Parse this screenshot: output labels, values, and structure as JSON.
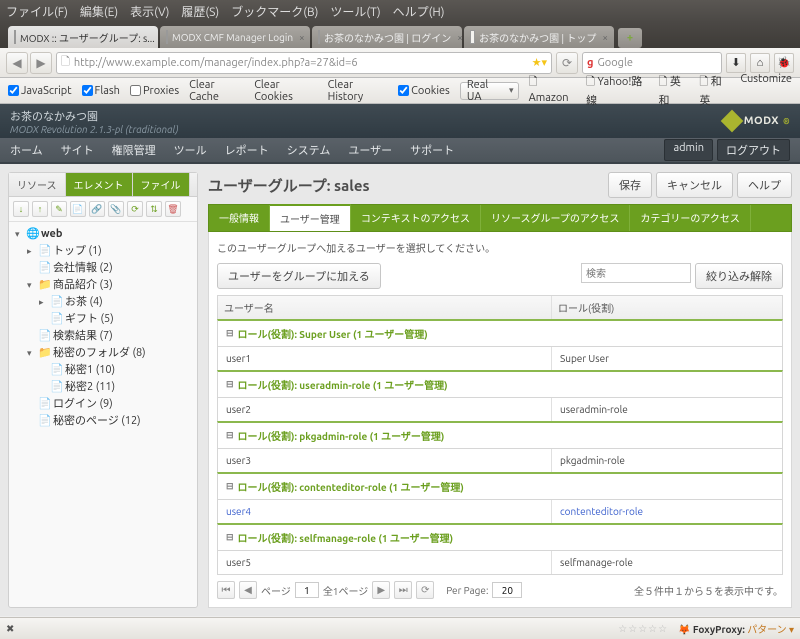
{
  "os_menu": [
    "ファイル(F)",
    "編集(E)",
    "表示(V)",
    "履歴(S)",
    "ブックマーク(B)",
    "ツール(T)",
    "ヘルプ(H)"
  ],
  "browser_tabs": [
    {
      "label": "MODX :: ユーザーグループ: s...",
      "active": true
    },
    {
      "label": "MODX CMF Manager Login",
      "active": false
    },
    {
      "label": "お茶のなかみつ園 | ログイン",
      "active": false
    },
    {
      "label": "お茶のなかみつ園 | トップ",
      "active": false
    }
  ],
  "url": "http://www.example.com/manager/index.php?a=27&id=6",
  "search_placeholder": "Google",
  "toolbar": {
    "javascript": "JavaScript",
    "flash": "Flash",
    "proxies": "Proxies",
    "clear_cache": "Clear Cache",
    "clear_cookies": "Clear Cookies",
    "clear_history": "Clear History",
    "cookies": "Cookies",
    "real_ua": "Real UA",
    "amazon": "Amazon",
    "yahoo": "Yahoo!路線",
    "eiwa": "英和",
    "waei": "和英",
    "customize": "Customize"
  },
  "modx": {
    "site_title": "お茶のなかみつ園",
    "version": "MODX Revolution 2.1.3-pl (traditional)",
    "logo": "MODX",
    "nav": [
      "ホーム",
      "サイト",
      "権限管理",
      "ツール",
      "レポート",
      "システム",
      "ユーザー",
      "サポート"
    ],
    "user": "admin",
    "logout": "ログアウト"
  },
  "left_tabs": [
    "リソース",
    "エレメント",
    "ファイル"
  ],
  "tree": {
    "root": "web",
    "items": [
      {
        "label": "トップ (1)",
        "indent": 1,
        "toggle": "▸",
        "icon": "📄"
      },
      {
        "label": "会社情報 (2)",
        "indent": 1,
        "toggle": "",
        "icon": "📄"
      },
      {
        "label": "商品紹介 (3)",
        "indent": 1,
        "toggle": "▾",
        "icon": "📁"
      },
      {
        "label": "お茶 (4)",
        "indent": 2,
        "toggle": "▸",
        "icon": "📄"
      },
      {
        "label": "ギフト (5)",
        "indent": 2,
        "toggle": "",
        "icon": "📄"
      },
      {
        "label": "検索結果 (7)",
        "indent": 1,
        "toggle": "",
        "icon": "📄"
      },
      {
        "label": "秘密のフォルダ (8)",
        "indent": 1,
        "toggle": "▾",
        "icon": "📁"
      },
      {
        "label": "秘密1 (10)",
        "indent": 2,
        "toggle": "",
        "icon": "📄"
      },
      {
        "label": "秘密2 (11)",
        "indent": 2,
        "toggle": "",
        "icon": "📄"
      },
      {
        "label": "ログイン (9)",
        "indent": 1,
        "toggle": "",
        "icon": "📄"
      },
      {
        "label": "秘密のページ (12)",
        "indent": 1,
        "toggle": "",
        "icon": "📄"
      }
    ]
  },
  "main": {
    "title": "ユーザーグループ: sales",
    "save": "保存",
    "cancel": "キャンセル",
    "help": "ヘルプ",
    "tabs": [
      "一般情報",
      "ユーザー管理",
      "コンテキストのアクセス",
      "リソースグループのアクセス",
      "カテゴリーのアクセス"
    ],
    "active_tab": 1,
    "instruction": "このユーザーグループへ加えるユーザーを選択してください。",
    "add_user_btn": "ユーザーをグループに加える",
    "search_placeholder": "検索",
    "clear_filter": "絞り込み解除",
    "col_user": "ユーザー名",
    "col_role": "ロール(役割)",
    "groups": [
      {
        "header": "ロール(役割): Super User (1 ユーザー管理)",
        "user": "user1",
        "role": "Super User"
      },
      {
        "header": "ロール(役割): useradmin-role (1 ユーザー管理)",
        "user": "user2",
        "role": "useradmin-role"
      },
      {
        "header": "ロール(役割): pkgadmin-role (1 ユーザー管理)",
        "user": "user3",
        "role": "pkgadmin-role"
      },
      {
        "header": "ロール(役割): contenteditor-role (1 ユーザー管理)",
        "user": "user4",
        "role": "contenteditor-role",
        "hover": true
      },
      {
        "header": "ロール(役割): selfmanage-role (1 ユーザー管理)",
        "user": "user5",
        "role": "selfmanage-role"
      }
    ],
    "pager": {
      "page_label": "ページ",
      "page_value": "1",
      "total": "全1ページ",
      "per_page_label": "Per Page:",
      "per_page": "20",
      "status": "全５件中１から５を表示中です。"
    }
  },
  "statusbar": {
    "foxy_label": "FoxyProxy:",
    "foxy_mode": "パターン"
  }
}
